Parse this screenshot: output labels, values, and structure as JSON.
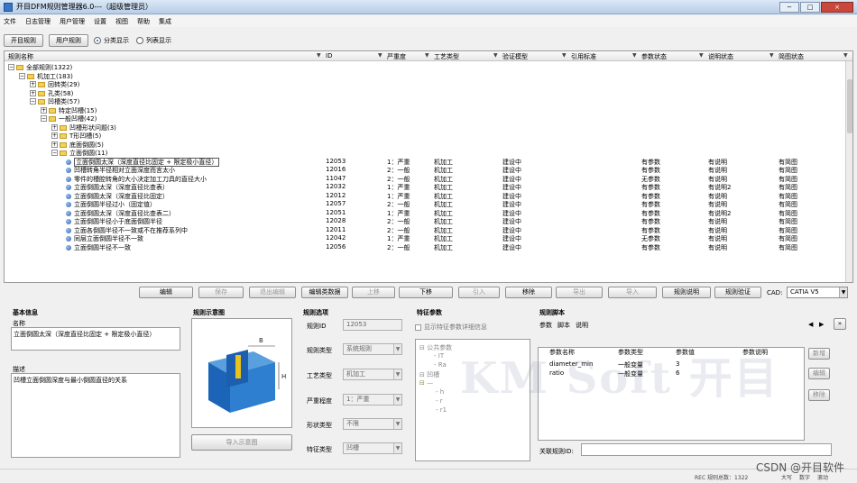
{
  "window": {
    "title": "开目DFM规则管理器6.0---（超级管理员）",
    "min": "−",
    "max": "□",
    "close": "×"
  },
  "menu": [
    "文件",
    "日志管理",
    "用户管理",
    "设置",
    "视图",
    "帮助",
    "集成"
  ],
  "toolbar": {
    "rule_btn": "开目规则",
    "user_btn": "用户规则",
    "radio_category": "分类显示",
    "radio_list": "列表显示",
    "selected": "category"
  },
  "grid": {
    "columns": [
      "规则名称",
      "ID",
      "严重度",
      "工艺类型",
      "验证模型",
      "引用标准",
      "参数状态",
      "说明状态",
      "简图状态"
    ],
    "tree": [
      {
        "indent": 0,
        "exp": "−",
        "kind": "folder",
        "label": "全部规则(1322)"
      },
      {
        "indent": 1,
        "exp": "−",
        "kind": "folder",
        "label": "机加工(183)"
      },
      {
        "indent": 2,
        "exp": "+",
        "kind": "folder",
        "label": "回转类(29)"
      },
      {
        "indent": 2,
        "exp": "+",
        "kind": "folder",
        "label": "孔类(58)"
      },
      {
        "indent": 2,
        "exp": "−",
        "kind": "folder",
        "label": "凹槽类(57)"
      },
      {
        "indent": 3,
        "exp": "+",
        "kind": "folder",
        "label": "特定凹槽(15)"
      },
      {
        "indent": 3,
        "exp": "−",
        "kind": "folder",
        "label": "一般凹槽(42)"
      },
      {
        "indent": 4,
        "exp": "+",
        "kind": "folder",
        "label": "凹槽形状问题(3)"
      },
      {
        "indent": 4,
        "exp": "+",
        "kind": "folder",
        "label": "T形凹槽(5)"
      },
      {
        "indent": 4,
        "exp": "+",
        "kind": "folder",
        "label": "底面倒圆(5)"
      },
      {
        "indent": 4,
        "exp": "−",
        "kind": "folder",
        "label": "立面倒圆(11)"
      }
    ],
    "rules": [
      {
        "label": "立面倒圆太深（深度直径比固定 + 限定极小直径）",
        "id": "12053",
        "sev": "1：严重",
        "proc": "机加工",
        "model": "建设中",
        "param": "有参数",
        "desc": "有说明",
        "img": "有简图"
      },
      {
        "label": "凹槽转角半径相对立面深度而言太小",
        "id": "12016",
        "sev": "2：一般",
        "proc": "机加工",
        "model": "建设中",
        "param": "有参数",
        "desc": "有说明",
        "img": "有简图"
      },
      {
        "label": "零件的槽腔转角的大小决定加工刀具的直径大小",
        "id": "11047",
        "sev": "2：一般",
        "proc": "机加工",
        "model": "建设中",
        "param": "无参数",
        "desc": "有说明",
        "img": "有简图"
      },
      {
        "label": "立面倒圆太深（深度直径比查表）",
        "id": "12032",
        "sev": "1：严重",
        "proc": "机加工",
        "model": "建设中",
        "param": "有参数",
        "desc": "有说明2",
        "img": "有简图"
      },
      {
        "label": "立面倒圆太深（深度直径比固定）",
        "id": "12012",
        "sev": "1：严重",
        "proc": "机加工",
        "model": "建设中",
        "param": "有参数",
        "desc": "有说明",
        "img": "有简图"
      },
      {
        "label": "立面倒圆半径过小（固定值）",
        "id": "12057",
        "sev": "2：一般",
        "proc": "机加工",
        "model": "建设中",
        "param": "有参数",
        "desc": "有说明",
        "img": "有简图"
      },
      {
        "label": "立面倒圆太深（深度直径比查表二）",
        "id": "12051",
        "sev": "1：严重",
        "proc": "机加工",
        "model": "建设中",
        "param": "有参数",
        "desc": "有说明2",
        "img": "有简图"
      },
      {
        "label": "立面倒圆半径小于底面倒圆半径",
        "id": "12028",
        "sev": "2：一般",
        "proc": "机加工",
        "model": "建设中",
        "param": "有参数",
        "desc": "有说明",
        "img": "有简图"
      },
      {
        "label": "立面各倒圆半径不一致或不在推荐系列中",
        "id": "12011",
        "sev": "2：一般",
        "proc": "机加工",
        "model": "建设中",
        "param": "有参数",
        "desc": "有说明",
        "img": "有简图"
      },
      {
        "label": "同层立面倒圆半径不一致",
        "id": "12042",
        "sev": "1：严重",
        "proc": "机加工",
        "model": "建设中",
        "param": "无参数",
        "desc": "有说明",
        "img": "有简图"
      },
      {
        "label": "立面倒圆半径不一致",
        "id": "12056",
        "sev": "2：一般",
        "proc": "机加工",
        "model": "建设中",
        "param": "有参数",
        "desc": "有说明",
        "img": "有简图"
      }
    ]
  },
  "actions": [
    {
      "label": "编辑",
      "enabled": true
    },
    {
      "label": "保存",
      "enabled": false
    },
    {
      "label": "退出编辑",
      "enabled": false
    },
    {
      "label": "编辑类数据",
      "enabled": true
    },
    {
      "label": "上移",
      "enabled": false
    },
    {
      "label": "下移",
      "enabled": true
    },
    {
      "label": "引入",
      "enabled": false
    },
    {
      "label": "移除",
      "enabled": true
    },
    {
      "label": "导出",
      "enabled": false
    },
    {
      "label": "导入",
      "enabled": false
    },
    {
      "label": "规则说明",
      "enabled": true
    },
    {
      "label": "规则验证",
      "enabled": true
    }
  ],
  "cad": {
    "label": "CAD:",
    "value": "CATIA V5"
  },
  "basic": {
    "title": "基本信息",
    "name_label": "名称",
    "name_value": "立面倒圆太深（深度直径比固定 + 限定极小直径）",
    "desc_label": "描述",
    "desc_value": "凹槽立面倒圆深度与最小倒圆直径的关系"
  },
  "diagram": {
    "title": "规则示意图",
    "import_btn": "导入示意图",
    "label_b": "B",
    "label_h": "H"
  },
  "options": {
    "title": "规则选项",
    "id_label": "规则ID",
    "id_value": "12053",
    "type_label": "规则类型",
    "type_value": "系统规则",
    "proc_label": "工艺类型",
    "proc_value": "机加工",
    "sev_label": "严重程度",
    "sev_value": "1：严重",
    "shape_label": "形状类型",
    "shape_value": "不限",
    "feat_label": "特征类型",
    "feat_value": "凹槽"
  },
  "feature": {
    "title": "特征参数",
    "show_detail": "显示特征参数详细信息",
    "tree": [
      "公共参数",
      "IT",
      "Ra",
      "凹槽",
      "h",
      "r",
      "r1"
    ]
  },
  "script": {
    "title": "规则脚本",
    "tabs": [
      "参数",
      "脚本",
      "说明"
    ],
    "columns": [
      "参数名称",
      "参数类型",
      "参数值",
      "参数说明"
    ],
    "rows": [
      {
        "name": "diameter_min",
        "type": "一般变量",
        "value": "3",
        "desc": ""
      },
      {
        "name": "ratio",
        "type": "一般变量",
        "value": "6",
        "desc": ""
      }
    ],
    "side": [
      "新增",
      "编辑",
      "移除"
    ],
    "related_label": "关联规则ID:",
    "nav_prev": "◀",
    "nav_next": "▶",
    "nav_more": "»"
  },
  "watermark": "KM Soft 开目",
  "status": {
    "text": "REC 规则总数：1322",
    "mode1": "大写",
    "mode2": "数字",
    "mode3": "滚动"
  },
  "csdn": "CSDN @开目软件"
}
